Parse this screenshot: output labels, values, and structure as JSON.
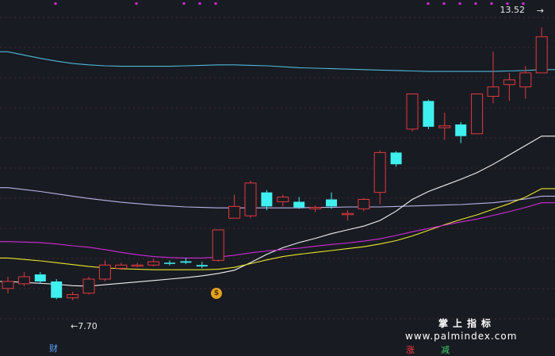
{
  "labels": {
    "high": "13.52",
    "low": "7.70",
    "cai_badge": "财",
    "brand_cn": "掌上指标",
    "watermark": "www.palmindex.com",
    "zhang_badge": "涨",
    "jian_badge": "减"
  },
  "icons": {
    "moneybag": "moneybag-icon",
    "arrow_high": "arrow-right-icon",
    "arrow_low": "arrow-left-icon"
  },
  "colors": {
    "background": "#191b22",
    "grid": "#3a2a30",
    "up": "#e0393e",
    "down": "#3ff0f0",
    "ma_cyan": "#4fb8d6",
    "ma_lavender": "#b8b2e8",
    "ma_white": "#f0f0f0",
    "ma_yellow": "#e8e82a",
    "ma_magenta": "#d02ad8"
  },
  "chart_data": {
    "type": "candlestick",
    "ylim": [
      7.0,
      13.8
    ],
    "candles": [
      {
        "o": 7.95,
        "c": 8.1,
        "h": 8.2,
        "l": 7.85
      },
      {
        "o": 8.05,
        "c": 8.2,
        "h": 8.3,
        "l": 8.0
      },
      {
        "o": 8.25,
        "c": 8.1,
        "h": 8.3,
        "l": 8.05
      },
      {
        "o": 8.1,
        "c": 7.75,
        "h": 8.15,
        "l": 7.72
      },
      {
        "o": 7.75,
        "c": 7.82,
        "h": 7.88,
        "l": 7.7
      },
      {
        "o": 7.85,
        "c": 8.15,
        "h": 8.2,
        "l": 7.82
      },
      {
        "o": 8.15,
        "c": 8.45,
        "h": 8.55,
        "l": 8.1
      },
      {
        "o": 8.38,
        "c": 8.45,
        "h": 8.5,
        "l": 8.35
      },
      {
        "o": 8.45,
        "c": 8.45,
        "h": 8.5,
        "l": 8.4
      },
      {
        "o": 8.45,
        "c": 8.52,
        "h": 8.58,
        "l": 8.42
      },
      {
        "o": 8.5,
        "c": 8.48,
        "h": 8.55,
        "l": 8.44
      },
      {
        "o": 8.53,
        "c": 8.5,
        "h": 8.6,
        "l": 8.47
      },
      {
        "o": 8.45,
        "c": 8.42,
        "h": 8.52,
        "l": 8.38
      },
      {
        "o": 8.55,
        "c": 9.2,
        "h": 9.2,
        "l": 8.52
      },
      {
        "o": 9.45,
        "c": 9.7,
        "h": 9.95,
        "l": 9.45
      },
      {
        "o": 9.5,
        "c": 10.2,
        "h": 10.25,
        "l": 9.45
      },
      {
        "o": 10.0,
        "c": 9.7,
        "h": 10.05,
        "l": 9.62
      },
      {
        "o": 9.8,
        "c": 9.9,
        "h": 9.95,
        "l": 9.7
      },
      {
        "o": 9.8,
        "c": 9.68,
        "h": 9.9,
        "l": 9.65
      },
      {
        "o": 9.65,
        "c": 9.68,
        "h": 9.72,
        "l": 9.58
      },
      {
        "o": 9.85,
        "c": 9.7,
        "h": 10.0,
        "l": 9.65
      },
      {
        "o": 9.55,
        "c": 9.55,
        "h": 9.62,
        "l": 9.4
      },
      {
        "o": 9.65,
        "c": 9.85,
        "h": 9.88,
        "l": 9.6
      },
      {
        "o": 10.0,
        "c": 10.85,
        "h": 10.9,
        "l": 9.75
      },
      {
        "o": 10.85,
        "c": 10.6,
        "h": 10.88,
        "l": 10.55
      },
      {
        "o": 11.35,
        "c": 12.1,
        "h": 12.1,
        "l": 11.3
      },
      {
        "o": 11.95,
        "c": 11.4,
        "h": 11.98,
        "l": 11.35
      },
      {
        "o": 11.38,
        "c": 11.42,
        "h": 11.7,
        "l": 11.12
      },
      {
        "o": 11.45,
        "c": 11.2,
        "h": 11.5,
        "l": 11.05
      },
      {
        "o": 11.25,
        "c": 12.1,
        "h": 12.1,
        "l": 11.25
      },
      {
        "o": 12.05,
        "c": 12.25,
        "h": 13.0,
        "l": 11.9
      },
      {
        "o": 12.3,
        "c": 12.4,
        "h": 12.55,
        "l": 11.95
      },
      {
        "o": 12.25,
        "c": 12.55,
        "h": 12.7,
        "l": 12.0
      },
      {
        "o": 12.55,
        "c": 13.32,
        "h": 13.52,
        "l": 12.55
      }
    ],
    "ma_lines": [
      {
        "name": "cyan",
        "color": "#4fb8d6",
        "values": [
          13.0,
          12.93,
          12.86,
          12.8,
          12.75,
          12.72,
          12.7,
          12.69,
          12.69,
          12.69,
          12.69,
          12.7,
          12.71,
          12.72,
          12.72,
          12.71,
          12.7,
          12.68,
          12.66,
          12.65,
          12.64,
          12.63,
          12.62,
          12.61,
          12.6,
          12.59,
          12.58,
          12.58,
          12.58,
          12.58,
          12.58,
          12.59,
          12.6,
          12.62
        ]
      },
      {
        "name": "lavender",
        "color": "#b8b2e8",
        "values": [
          10.1,
          10.06,
          10.02,
          9.97,
          9.92,
          9.87,
          9.83,
          9.79,
          9.76,
          9.73,
          9.71,
          9.69,
          9.68,
          9.67,
          9.67,
          9.67,
          9.67,
          9.67,
          9.67,
          9.68,
          9.68,
          9.69,
          9.69,
          9.69,
          9.7,
          9.71,
          9.72,
          9.73,
          9.74,
          9.76,
          9.78,
          9.82,
          9.86,
          9.92
        ]
      },
      {
        "name": "white",
        "color": "#f0f0f0",
        "values": [
          8.1,
          8.08,
          8.06,
          8.04,
          8.01,
          8.0,
          8.03,
          8.06,
          8.09,
          8.12,
          8.15,
          8.18,
          8.22,
          8.27,
          8.34,
          8.5,
          8.68,
          8.82,
          8.93,
          9.02,
          9.12,
          9.2,
          9.28,
          9.4,
          9.6,
          9.85,
          10.02,
          10.15,
          10.28,
          10.42,
          10.6,
          10.8,
          11.0,
          11.2
        ]
      },
      {
        "name": "yellow",
        "color": "#e8e82a",
        "values": [
          8.6,
          8.57,
          8.54,
          8.5,
          8.46,
          8.42,
          8.39,
          8.37,
          8.36,
          8.35,
          8.35,
          8.35,
          8.35,
          8.36,
          8.4,
          8.48,
          8.56,
          8.63,
          8.68,
          8.72,
          8.76,
          8.8,
          8.84,
          8.9,
          8.97,
          9.07,
          9.19,
          9.31,
          9.42,
          9.52,
          9.64,
          9.76,
          9.9,
          10.08
        ]
      },
      {
        "name": "magenta",
        "color": "#d02ad8",
        "values": [
          8.95,
          8.94,
          8.93,
          8.9,
          8.86,
          8.83,
          8.78,
          8.72,
          8.67,
          8.63,
          8.61,
          8.6,
          8.6,
          8.62,
          8.66,
          8.71,
          8.75,
          8.78,
          8.81,
          8.85,
          8.89,
          8.92,
          8.96,
          9.01,
          9.08,
          9.16,
          9.23,
          9.3,
          9.37,
          9.43,
          9.51,
          9.59,
          9.68,
          9.78
        ]
      }
    ]
  }
}
